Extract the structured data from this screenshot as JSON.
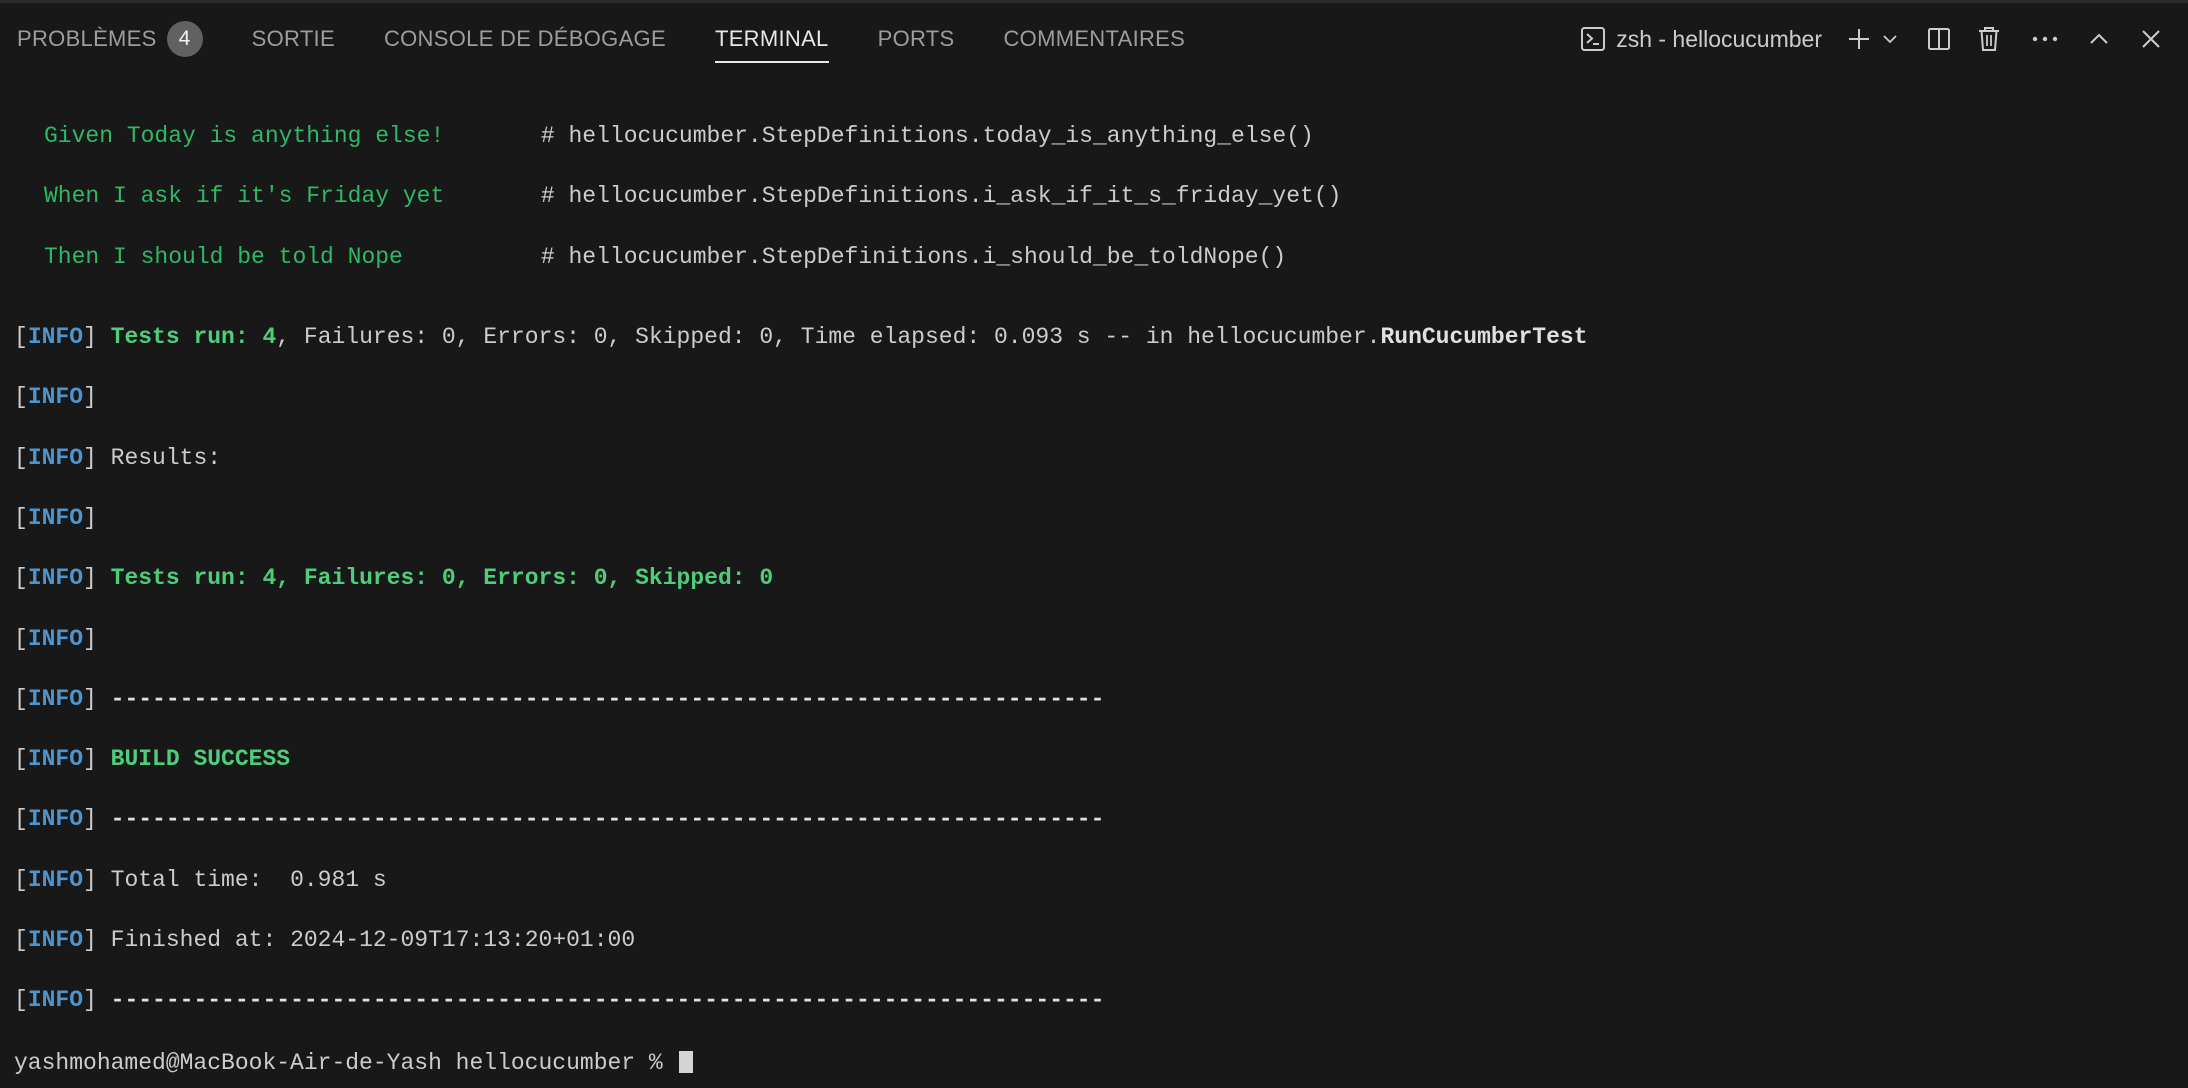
{
  "tabs": [
    {
      "label": "PROBLÈMES",
      "badge": "4"
    },
    {
      "label": "SORTIE"
    },
    {
      "label": "CONSOLE DE DÉBOGAGE"
    },
    {
      "label": "TERMINAL",
      "active": true
    },
    {
      "label": "PORTS"
    },
    {
      "label": "COMMENTAIRES"
    }
  ],
  "terminal_select": {
    "label": "zsh - hellocucumber"
  },
  "icons": {
    "terminal": "terminal-icon",
    "add": "plus-icon",
    "dropdown": "chevron-down-icon",
    "split": "split-icon",
    "kill": "trash-icon",
    "more": "more-icon",
    "maximize": "chevron-up-icon",
    "close": "close-icon"
  },
  "colors": {
    "background": "#181818",
    "step_green": "#2fb866",
    "success_green": "#4ece7b",
    "info_blue": "#4e94ce"
  },
  "steps": [
    {
      "text": "Given Today is anything else!       ",
      "comment": "# hellocucumber.StepDefinitions.today_is_anything_else()"
    },
    {
      "text": "When I ask if it's Friday yet       ",
      "comment": "# hellocucumber.StepDefinitions.i_ask_if_it_s_friday_yet()"
    },
    {
      "text": "Then I should be told Nope          ",
      "comment": "# hellocucumber.StepDefinitions.i_should_be_toldNope()"
    }
  ],
  "info_tag": "INFO",
  "output": {
    "tests_run_summary": "Tests run: 4",
    "tests_run_rest": ", Failures: 0, Errors: 0, Skipped: 0, Time elapsed: 0.093 s -- in hellocucumber.",
    "test_class": "RunCucumberTest",
    "results": "Results:",
    "totals": "Tests run: 4, Failures: 0, Errors: 0, Skipped: 0",
    "separator": "------------------------------------------------------------------------",
    "build_status": "BUILD SUCCESS",
    "total_time": "Total time:  0.981 s",
    "finished_at": "Finished at: 2024-12-09T17:13:20+01:00"
  },
  "prompt": "yashmohamed@MacBook-Air-de-Yash hellocucumber % "
}
